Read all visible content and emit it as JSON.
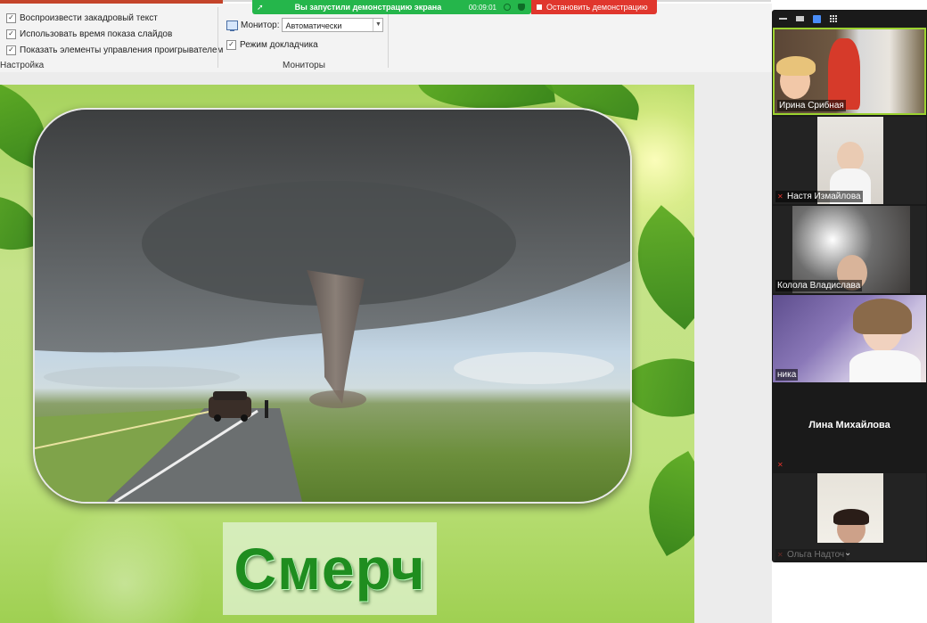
{
  "ribbon": {
    "options": [
      {
        "label": "Воспроизвести закадровый текст",
        "checked": true
      },
      {
        "label": "Использовать время показа слайдов",
        "checked": true
      },
      {
        "label": "Показать элементы управления проигрывателем",
        "checked": true
      }
    ],
    "setup_group_label": "Настройка",
    "monitor_label": "Монитор:",
    "monitor_value": "Автоматически",
    "presenter_view_label": "Режим докладчика",
    "presenter_view_checked": true,
    "monitors_group_label": "Мониторы"
  },
  "share_bar": {
    "message": "Вы запустили демонстрацию экрана",
    "timer": "00:09:01",
    "stop_label": "Остановить демонстрацию"
  },
  "slide": {
    "title": "Смерч"
  },
  "participants": [
    {
      "name": "Ирина Срибная",
      "muted": false,
      "active": true,
      "has_video": true
    },
    {
      "name": "Настя Измайлова",
      "muted": true,
      "active": false,
      "has_video": true
    },
    {
      "name": "Колола Владислава",
      "muted": false,
      "active": false,
      "has_video": true
    },
    {
      "name": "ника",
      "muted": false,
      "active": false,
      "has_video": true
    },
    {
      "name": "Лина Михайлова",
      "muted": true,
      "active": false,
      "has_video": false
    },
    {
      "name": "Ольга Надточ",
      "muted": true,
      "active": false,
      "has_video": true
    }
  ],
  "icons": {
    "share": "share-screen-icon",
    "stop": "stop-square-icon",
    "pause": "pause-icon",
    "security": "shield-icon",
    "more": "chevron-down-icon"
  },
  "colors": {
    "share_green": "#25b64b",
    "stop_red": "#e0362d",
    "active_speaker": "#9bd22f",
    "title_green": "#1f8d1f"
  }
}
